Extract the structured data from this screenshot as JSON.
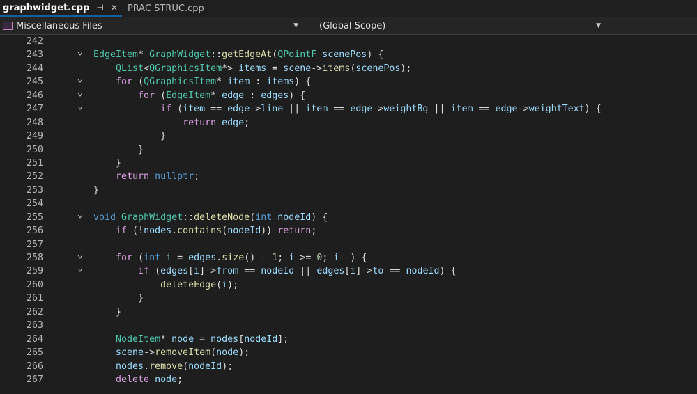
{
  "tabs": [
    {
      "label": "graphwidget.cpp",
      "active": true,
      "pin": "⊣",
      "close": "✕"
    },
    {
      "label": "PRAC STRUC.cpp",
      "active": false
    }
  ],
  "navbar": {
    "project": "Miscellaneous Files",
    "scope": "(Global Scope)"
  },
  "editor": {
    "lines": [
      {
        "n": "242",
        "fold": false,
        "parts": []
      },
      {
        "n": "243",
        "fold": true,
        "parts": [
          [
            "ty",
            "EdgeItem"
          ],
          [
            "",
            "* "
          ],
          [
            "ty",
            "GraphWidget"
          ],
          [
            "",
            "::"
          ],
          [
            "fn",
            "getEdgeAt"
          ],
          [
            "",
            "("
          ],
          [
            "ty",
            "QPointF"
          ],
          [
            "",
            ""
          ],
          [
            "var",
            " scenePos"
          ],
          [
            "",
            ") {"
          ]
        ]
      },
      {
        "n": "244",
        "fold": false,
        "parts": [
          [
            "",
            "    "
          ],
          [
            "ty",
            "QList"
          ],
          [
            "",
            "<"
          ],
          [
            "ty",
            "QGraphicsItem"
          ],
          [
            "",
            "*> "
          ],
          [
            "var",
            "items"
          ],
          [
            "",
            " = "
          ],
          [
            "var",
            "scene"
          ],
          [
            "",
            "->"
          ],
          [
            "fn",
            "items"
          ],
          [
            "",
            "("
          ],
          [
            "var",
            "scenePos"
          ],
          [
            "",
            ");"
          ]
        ]
      },
      {
        "n": "245",
        "fold": true,
        "parts": [
          [
            "",
            "    "
          ],
          [
            "ctl",
            "for"
          ],
          [
            "",
            " ("
          ],
          [
            "ty",
            "QGraphicsItem"
          ],
          [
            "",
            "* "
          ],
          [
            "var",
            "item"
          ],
          [
            "",
            " : "
          ],
          [
            "var",
            "items"
          ],
          [
            "",
            ") {"
          ]
        ]
      },
      {
        "n": "246",
        "fold": true,
        "parts": [
          [
            "",
            "        "
          ],
          [
            "ctl",
            "for"
          ],
          [
            "",
            " ("
          ],
          [
            "ty",
            "EdgeItem"
          ],
          [
            "",
            "* "
          ],
          [
            "var",
            "edge"
          ],
          [
            "",
            " : "
          ],
          [
            "var",
            "edges"
          ],
          [
            "",
            ") {"
          ]
        ]
      },
      {
        "n": "247",
        "fold": true,
        "parts": [
          [
            "",
            "            "
          ],
          [
            "ctl",
            "if"
          ],
          [
            "",
            " ("
          ],
          [
            "var",
            "item"
          ],
          [
            "",
            " == "
          ],
          [
            "var",
            "edge"
          ],
          [
            "",
            "->"
          ],
          [
            "var",
            "line"
          ],
          [
            "",
            " || "
          ],
          [
            "var",
            "item"
          ],
          [
            "",
            " == "
          ],
          [
            "var",
            "edge"
          ],
          [
            "",
            "->"
          ],
          [
            "var",
            "weightBg"
          ],
          [
            "",
            " || "
          ],
          [
            "var",
            "item"
          ],
          [
            "",
            " == "
          ],
          [
            "var",
            "edge"
          ],
          [
            "",
            "->"
          ],
          [
            "var",
            "weightText"
          ],
          [
            "",
            ") {"
          ]
        ]
      },
      {
        "n": "248",
        "fold": false,
        "parts": [
          [
            "",
            "                "
          ],
          [
            "ctl",
            "return"
          ],
          [
            "",
            " "
          ],
          [
            "var",
            "edge"
          ],
          [
            "",
            ";"
          ]
        ]
      },
      {
        "n": "249",
        "fold": false,
        "parts": [
          [
            "",
            "            }"
          ]
        ]
      },
      {
        "n": "250",
        "fold": false,
        "parts": [
          [
            "",
            "        }"
          ]
        ]
      },
      {
        "n": "251",
        "fold": false,
        "parts": [
          [
            "",
            "    }"
          ]
        ]
      },
      {
        "n": "252",
        "fold": false,
        "parts": [
          [
            "",
            "    "
          ],
          [
            "ctl",
            "return"
          ],
          [
            "",
            " "
          ],
          [
            "kw",
            "nullptr"
          ],
          [
            "",
            ";"
          ]
        ]
      },
      {
        "n": "253",
        "fold": false,
        "parts": [
          [
            "",
            "}"
          ]
        ]
      },
      {
        "n": "254",
        "fold": false,
        "parts": []
      },
      {
        "n": "255",
        "fold": true,
        "parts": [
          [
            "kw",
            "void"
          ],
          [
            "",
            " "
          ],
          [
            "ty",
            "GraphWidget"
          ],
          [
            "",
            "::"
          ],
          [
            "fn",
            "deleteNode"
          ],
          [
            "",
            "("
          ],
          [
            "kw",
            "int"
          ],
          [
            "",
            " "
          ],
          [
            "var",
            "nodeId"
          ],
          [
            "",
            ") {"
          ]
        ]
      },
      {
        "n": "256",
        "fold": false,
        "parts": [
          [
            "",
            "    "
          ],
          [
            "ctl",
            "if"
          ],
          [
            "",
            " (!"
          ],
          [
            "var",
            "nodes"
          ],
          [
            "",
            "."
          ],
          [
            "fn",
            "contains"
          ],
          [
            "",
            "("
          ],
          [
            "var",
            "nodeId"
          ],
          [
            "",
            ")) "
          ],
          [
            "ctl",
            "return"
          ],
          [
            "",
            ";"
          ]
        ]
      },
      {
        "n": "257",
        "fold": false,
        "parts": []
      },
      {
        "n": "258",
        "fold": true,
        "parts": [
          [
            "",
            "    "
          ],
          [
            "ctl",
            "for"
          ],
          [
            "",
            " ("
          ],
          [
            "kw",
            "int"
          ],
          [
            "",
            " "
          ],
          [
            "var",
            "i"
          ],
          [
            "",
            " = "
          ],
          [
            "var",
            "edges"
          ],
          [
            "",
            "."
          ],
          [
            "fn",
            "size"
          ],
          [
            "",
            "() - "
          ],
          [
            "num",
            "1"
          ],
          [
            "",
            "; "
          ],
          [
            "var",
            "i"
          ],
          [
            "",
            " >= "
          ],
          [
            "num",
            "0"
          ],
          [
            "",
            "; "
          ],
          [
            "var",
            "i"
          ],
          [
            "",
            "--) {"
          ]
        ]
      },
      {
        "n": "259",
        "fold": true,
        "parts": [
          [
            "",
            "        "
          ],
          [
            "ctl",
            "if"
          ],
          [
            "",
            " ("
          ],
          [
            "var",
            "edges"
          ],
          [
            "",
            "["
          ],
          [
            "var",
            "i"
          ],
          [
            "",
            "]->"
          ],
          [
            "var",
            "from"
          ],
          [
            "",
            " == "
          ],
          [
            "var",
            "nodeId"
          ],
          [
            "",
            " || "
          ],
          [
            "var",
            "edges"
          ],
          [
            "",
            "["
          ],
          [
            "var",
            "i"
          ],
          [
            "",
            "]->"
          ],
          [
            "var",
            "to"
          ],
          [
            "",
            " == "
          ],
          [
            "var",
            "nodeId"
          ],
          [
            "",
            ") {"
          ]
        ]
      },
      {
        "n": "260",
        "fold": false,
        "parts": [
          [
            "",
            "            "
          ],
          [
            "fn",
            "deleteEdge"
          ],
          [
            "",
            "("
          ],
          [
            "var",
            "i"
          ],
          [
            "",
            ");"
          ]
        ]
      },
      {
        "n": "261",
        "fold": false,
        "parts": [
          [
            "",
            "        }"
          ]
        ]
      },
      {
        "n": "262",
        "fold": false,
        "parts": [
          [
            "",
            "    }"
          ]
        ]
      },
      {
        "n": "263",
        "fold": false,
        "parts": []
      },
      {
        "n": "264",
        "fold": false,
        "parts": [
          [
            "",
            "    "
          ],
          [
            "ty",
            "NodeItem"
          ],
          [
            "",
            "* "
          ],
          [
            "var",
            "node"
          ],
          [
            "",
            " = "
          ],
          [
            "var",
            "nodes"
          ],
          [
            "",
            "["
          ],
          [
            "var",
            "nodeId"
          ],
          [
            "",
            "];"
          ]
        ]
      },
      {
        "n": "265",
        "fold": false,
        "parts": [
          [
            "",
            "    "
          ],
          [
            "var",
            "scene"
          ],
          [
            "",
            "->"
          ],
          [
            "fn",
            "removeItem"
          ],
          [
            "",
            "("
          ],
          [
            "var",
            "node"
          ],
          [
            "",
            ");"
          ]
        ]
      },
      {
        "n": "266",
        "fold": false,
        "parts": [
          [
            "",
            "    "
          ],
          [
            "var",
            "nodes"
          ],
          [
            "",
            "."
          ],
          [
            "fn",
            "remove"
          ],
          [
            "",
            "("
          ],
          [
            "var",
            "nodeId"
          ],
          [
            "",
            ");"
          ]
        ]
      },
      {
        "n": "267",
        "fold": false,
        "parts": [
          [
            "",
            "    "
          ],
          [
            "ctl",
            "delete"
          ],
          [
            "",
            " "
          ],
          [
            "var",
            "node"
          ],
          [
            "",
            ";"
          ]
        ]
      }
    ]
  }
}
